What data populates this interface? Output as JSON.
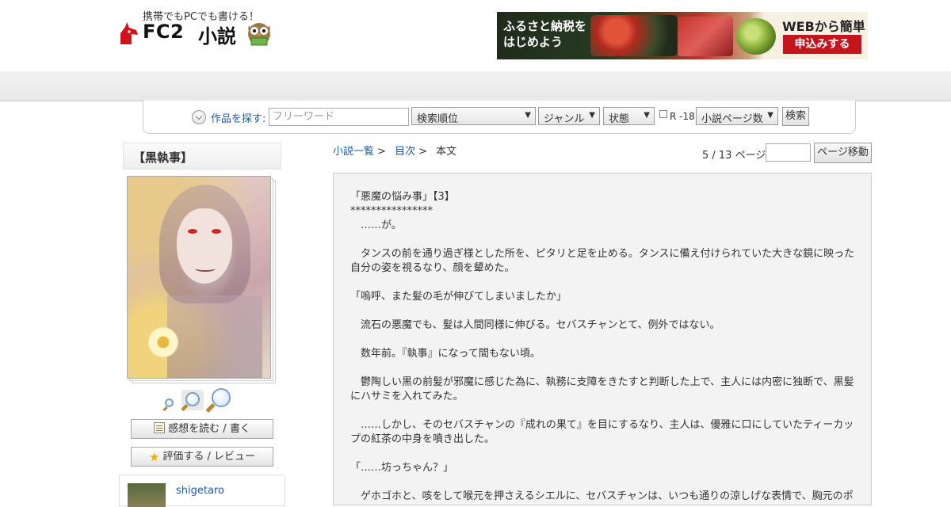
{
  "header": {
    "tagline": "携帯でもPCでも書ける！",
    "logo_fc2": "FC2",
    "logo_shosetsu": "小説",
    "banner": {
      "left_line1": "ふるさと納税を",
      "left_line2": "はじめよう",
      "right_line1": "WEBから簡単",
      "right_button": "申込みする"
    }
  },
  "search": {
    "label": "作品を探す:",
    "placeholder": "フリーワード",
    "sort_value": "検索順位",
    "genre_value": "ジャンル",
    "status_value": "状態",
    "r18_label": "R -18",
    "pages_value": "小説ページ数",
    "submit_label": "検索"
  },
  "sidebar": {
    "title": "【黒執事】",
    "impressions_button": "感想を読む / 書く",
    "review_button": "評価する / レビュー",
    "author_name": "shigetaro"
  },
  "breadcrumb": {
    "list_link": "小説一覧",
    "toc_link": "目次",
    "current": "本文",
    "sep": ">"
  },
  "pager": {
    "status": "5 / 13 ページ",
    "page_value": "",
    "move_button": "ページ移動"
  },
  "story": {
    "heading": "「悪魔の悩み事」【3】",
    "divider": "****************",
    "paragraphs": [
      "　……が。",
      "　タンスの前を通り過ぎ様とした所を、ピタリと足を止める。タンスに備え付けられていた大きな鏡に映った自分の姿を視るなり、顔を顰めた。",
      "「嗚呼、また髪の毛が伸びてしまいましたか」",
      "　流石の悪魔でも、髪は人間同様に伸びる。セバスチャンとて、例外ではない。",
      "　数年前。『執事』になって間もない頃。",
      "　鬱陶しい黒の前髪が邪魔に感じた為に、執務に支障をきたすと判断した上で、主人には内密に独断で、黒髪にハサミを入れてみた。",
      "　……しかし、そのセバスチャンの『成れの果て』を目にするなり、主人は、優雅に口にしていたティーカップの紅茶の中身を噴き出した。",
      "「……坊っちゃん？」",
      "　ゲホゴホと、咳をして喉元を押さえるシエルに、セバスチャンは、いつも通りの涼しげな表情で、胸元のポ"
    ]
  }
}
